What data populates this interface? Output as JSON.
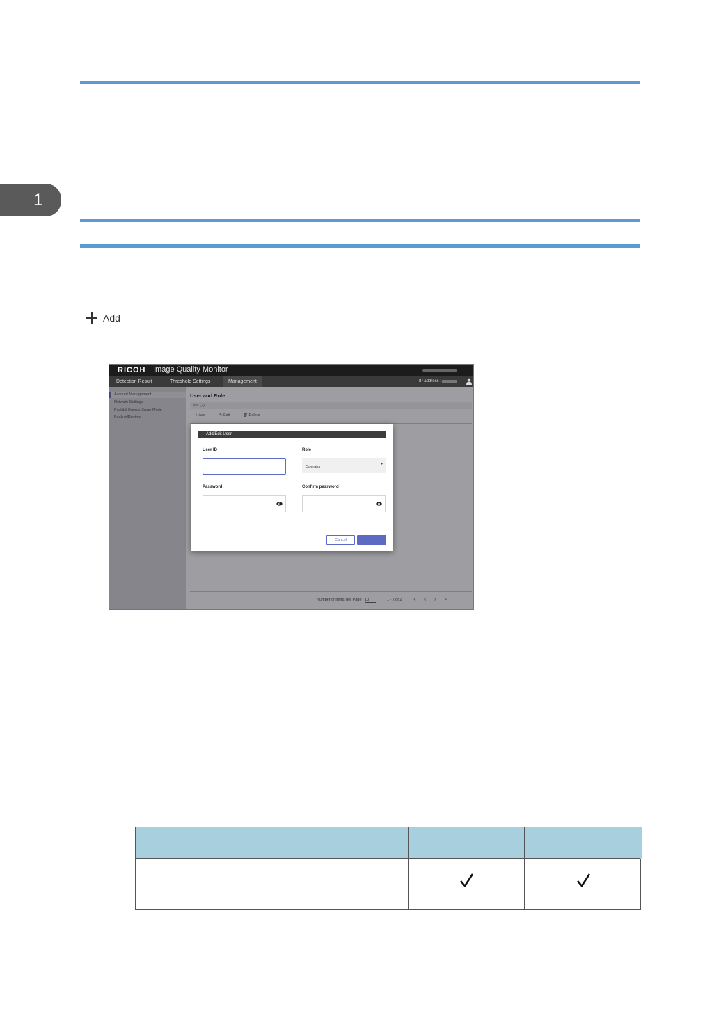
{
  "chapter": {
    "number": "1"
  },
  "doc": {
    "add_label": "Add"
  },
  "screenshot": {
    "brand": "RICOH",
    "app_title": "Image Quality Monitor",
    "nav": [
      "Detection Result",
      "Threshold Settings",
      "Management"
    ],
    "ip_label": "IP address :",
    "sidebar": [
      "Account Management",
      "Network Settings",
      "Prohibit Energy Saver Mode",
      "Backup/Restore"
    ],
    "content_title": "User and Role",
    "user_count": "User (2)",
    "toolbar": {
      "add": "Add",
      "edit": "Edit",
      "delete": "Delete"
    },
    "pager": {
      "label": "Number of Items per Page",
      "per_page": "10",
      "range": "1 - 2 of 2"
    },
    "dialog": {
      "title": "Add/Edit User",
      "user_id_label": "User ID",
      "role_label": "Role",
      "role_value": "Operator",
      "password_label": "Password",
      "confirm_label": "Confirm password",
      "cancel": "Cancel"
    }
  },
  "colors": {
    "accent_rule": "#5b9bd5",
    "table_header": "#a8cfde",
    "dialog_accent": "#5c6ac4"
  },
  "table": {
    "checks": [
      "check-icon",
      "check-icon"
    ]
  }
}
